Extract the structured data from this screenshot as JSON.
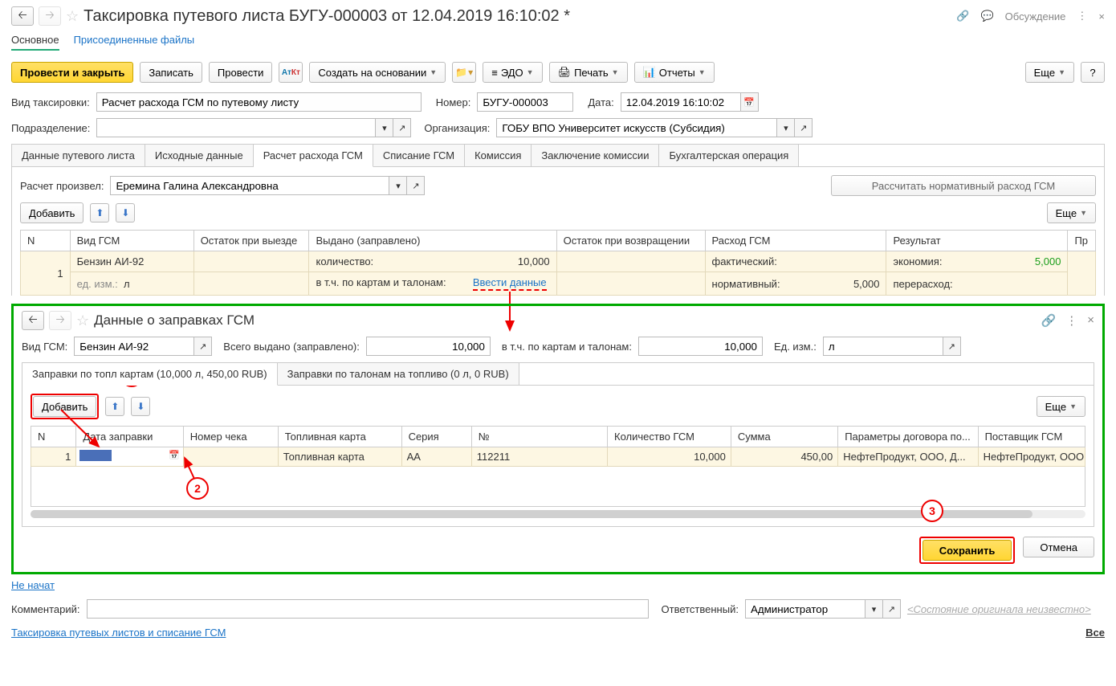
{
  "header": {
    "title": "Таксировка путевого листа БУГУ-000003 от 12.04.2019 16:10:02 *",
    "discuss": "Обсуждение"
  },
  "nav": {
    "main": "Основное",
    "files": "Присоединенные файлы"
  },
  "cmd": {
    "post_close": "Провести и закрыть",
    "write": "Записать",
    "post": "Провести",
    "create_based": "Создать на основании",
    "edo": "ЭДО",
    "print": "Печать",
    "reports": "Отчеты",
    "more": "Еще"
  },
  "form": {
    "type_lbl": "Вид таксировки:",
    "type_val": "Расчет расхода ГСМ по путевому листу",
    "num_lbl": "Номер:",
    "num_val": "БУГУ-000003",
    "date_lbl": "Дата:",
    "date_val": "12.04.2019 16:10:02",
    "dept_lbl": "Подразделение:",
    "dept_val": "",
    "org_lbl": "Организация:",
    "org_val": "ГОБУ ВПО Университет искусств (Субсидия)"
  },
  "tabs": {
    "t1": "Данные путевого листа",
    "t2": "Исходные данные",
    "t3": "Расчет расхода ГСМ",
    "t4": "Списание ГСМ",
    "t5": "Комиссия",
    "t6": "Заключение комиссии",
    "t7": "Бухгалтерская операция"
  },
  "calc": {
    "by_lbl": "Расчет произвел:",
    "by_val": "Еремина Галина Александровна",
    "calc_btn": "Рассчитать нормативный расход ГСМ",
    "add": "Добавить",
    "more": "Еще"
  },
  "tbl1": {
    "h_n": "N",
    "h_type": "Вид ГСМ",
    "h_out": "Остаток при выезде",
    "h_issued": "Выдано (заправлено)",
    "h_ret": "Остаток при возвращении",
    "h_cons": "Расход ГСМ",
    "h_res": "Результат",
    "h_pr": "Пр",
    "r_n": "1",
    "r_type": "Бензин АИ-92",
    "r_qty_lbl": "количество:",
    "r_qty": "10,000",
    "r_fact_lbl": "фактический:",
    "r_econ_lbl": "экономия:",
    "r_econ": "5,000",
    "r_unit_lbl": "ед. изм.:",
    "r_unit": "л",
    "r_cards_lbl": "в т.ч. по картам и талонам:",
    "r_enter": "Ввести данные",
    "r_norm_lbl": "нормативный:",
    "r_norm": "5,000",
    "r_over_lbl": "перерасход:"
  },
  "modal": {
    "title": "Данные о заправках ГСМ",
    "type_lbl": "Вид ГСМ:",
    "type_val": "Бензин АИ-92",
    "total_lbl": "Всего выдано (заправлено):",
    "total_val": "10,000",
    "cards_lbl": "в т.ч. по картам и талонам:",
    "cards_val": "10,000",
    "unit_lbl": "Ед. изм.:",
    "unit_val": "л",
    "tab1": "Заправки по топливным картам (10,000 л, 450,00 RUB)",
    "tab1_cut": "Заправки по топл           картам (10,000 л, 450,00 RUB)",
    "tab2": "Заправки по талонам на топливо (0 л, 0  RUB)",
    "add": "Добавить",
    "more": "Еще",
    "save": "Сохранить",
    "cancel": "Отмена"
  },
  "tbl2": {
    "h_n": "N",
    "h_date": "Дата заправки",
    "h_check": "Номер чека",
    "h_card": "Топливная карта",
    "h_series": "Серия",
    "h_num": "№",
    "h_qty": "Количество ГСМ",
    "h_sum": "Сумма",
    "h_params": "Параметры договора по...",
    "h_supplier": "Поставщик ГСМ",
    "r_n": "1",
    "r_card": "Топливная карта",
    "r_series": "АА",
    "r_num": "112211",
    "r_qty": "10,000",
    "r_sum": "450,00",
    "r_params": "НефтеПродукт, ООО, Д...",
    "r_supplier": "НефтеПродукт, ООО"
  },
  "footer": {
    "not_started": "Не начат",
    "comment_lbl": "Комментарий:",
    "resp_lbl": "Ответственный:",
    "resp_val": "Администратор",
    "state": "<Состояние оригинала неизвестно>",
    "bottom_link": "Таксировка путевых листов и списание ГСМ",
    "all": "Все"
  }
}
